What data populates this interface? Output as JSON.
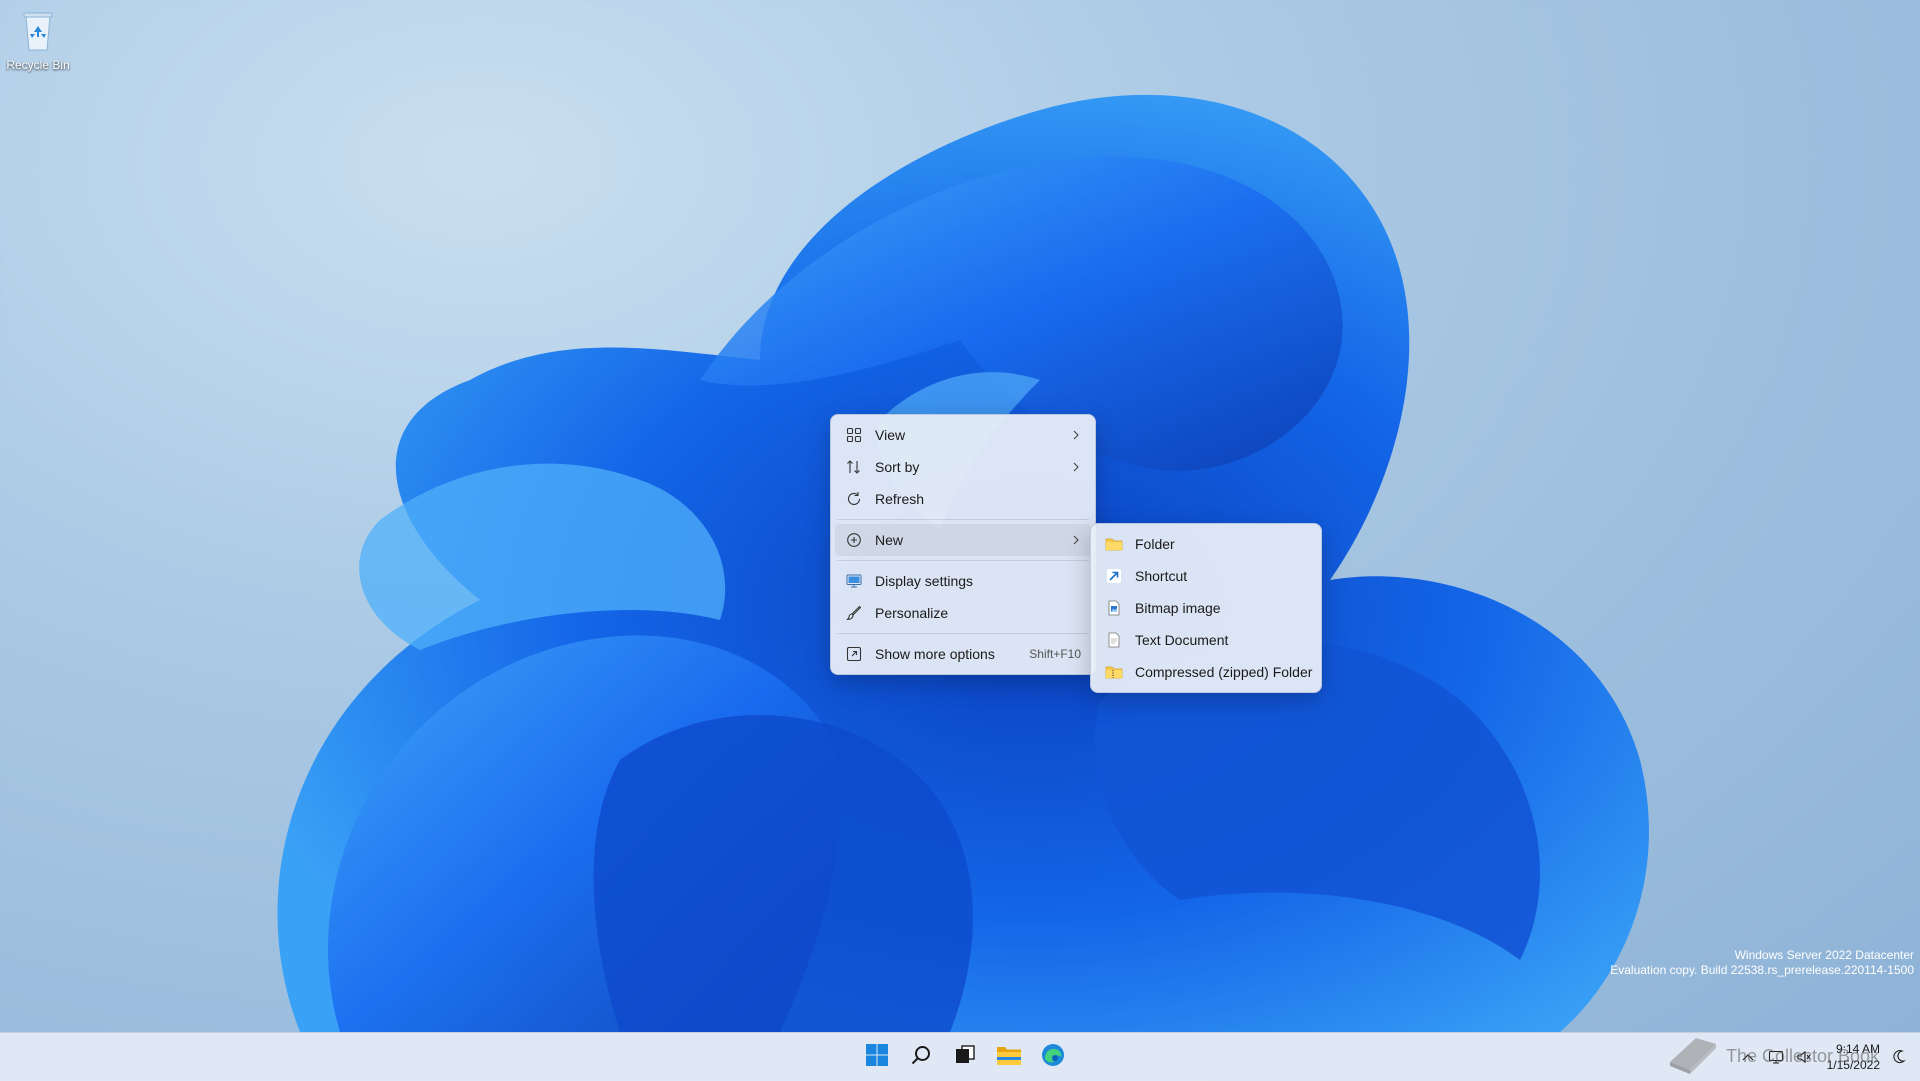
{
  "desktop": {
    "icons": [
      {
        "label": "Recycle Bin",
        "icon": "recycle-bin-icon"
      }
    ]
  },
  "context_menu": {
    "items": [
      {
        "label": "View",
        "icon": "grid-icon",
        "submenu": true
      },
      {
        "label": "Sort by",
        "icon": "sort-icon",
        "submenu": true
      },
      {
        "label": "Refresh",
        "icon": "refresh-icon"
      },
      {
        "label": "New",
        "icon": "plus-circle-icon",
        "submenu": true,
        "active": true
      },
      {
        "label": "Display settings",
        "icon": "display-icon"
      },
      {
        "label": "Personalize",
        "icon": "brush-icon"
      },
      {
        "label": "Show more options",
        "icon": "expand-icon",
        "shortcut": "Shift+F10"
      }
    ]
  },
  "new_submenu": {
    "items": [
      {
        "label": "Folder",
        "icon": "folder-icon"
      },
      {
        "label": "Shortcut",
        "icon": "shortcut-icon"
      },
      {
        "label": "Bitmap image",
        "icon": "bitmap-icon"
      },
      {
        "label": "Text Document",
        "icon": "text-document-icon"
      },
      {
        "label": "Compressed (zipped) Folder",
        "icon": "zip-folder-icon"
      }
    ]
  },
  "watermark": {
    "line1": "Windows Server 2022 Datacenter",
    "line2": "Evaluation copy. Build 22538.rs_prerelease.220114-1500"
  },
  "taskbar": {
    "apps": [
      "start-icon",
      "search-icon",
      "task-view-icon",
      "file-explorer-icon",
      "edge-icon"
    ],
    "time": "9:14 AM",
    "date": "1/15/2022"
  },
  "overlay_logo": {
    "text": "The Collector Book"
  },
  "colors": {
    "accent": "#0078d4",
    "menu_bg": "#e9eef7",
    "wallpaper_blue": "#1a63e0"
  }
}
